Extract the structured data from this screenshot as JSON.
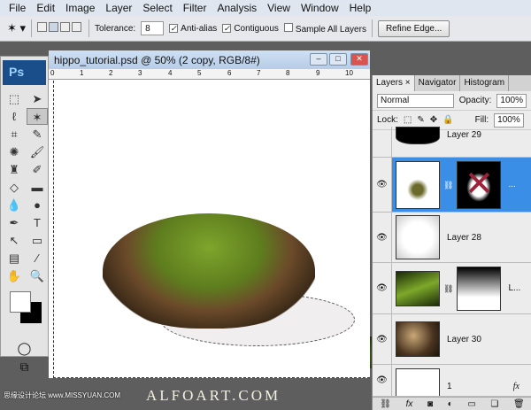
{
  "menu": [
    "File",
    "Edit",
    "Image",
    "Layer",
    "Select",
    "Filter",
    "Analysis",
    "View",
    "Window",
    "Help"
  ],
  "options": {
    "tool_icon": "magic-wand-icon",
    "tolerance_label": "Tolerance:",
    "tolerance_value": "8",
    "anti_alias": {
      "label": "Anti-alias",
      "checked": true
    },
    "contiguous": {
      "label": "Contiguous",
      "checked": true
    },
    "sample_all": {
      "label": "Sample All Layers",
      "checked": false
    },
    "refine_edge": "Refine Edge..."
  },
  "toolbox": {
    "logo": "Ps",
    "tools": [
      "marquee",
      "move",
      "lasso",
      "magic-wand",
      "crop",
      "slice",
      "healing",
      "brush",
      "stamp",
      "history-brush",
      "eraser",
      "gradient",
      "blur",
      "dodge",
      "pen",
      "type",
      "path-select",
      "shape",
      "notes",
      "eyedropper",
      "hand",
      "zoom"
    ],
    "active": "magic-wand",
    "foreground": "#ffffff",
    "background": "#000000"
  },
  "document": {
    "title": "hippo_tutorial.psd @ 50% (2 copy, RGB/8#)",
    "ruler": [
      "0",
      "1",
      "2",
      "3",
      "4",
      "5",
      "6",
      "7",
      "8",
      "9",
      "10"
    ]
  },
  "layers_panel": {
    "tabs": [
      "Layers ×",
      "Navigator",
      "Histogram"
    ],
    "blend_mode": "Normal",
    "opacity_label": "Opacity:",
    "opacity": "100%",
    "lock_label": "Lock:",
    "fill_label": "Fill:",
    "fill": "100%",
    "layers": [
      {
        "name": "Layer 29",
        "visible": false
      },
      {
        "name": "...",
        "visible": true,
        "selected": true
      },
      {
        "name": "Layer 28",
        "visible": true
      },
      {
        "name": "L...",
        "visible": true
      },
      {
        "name": "Layer 30",
        "visible": true
      },
      {
        "name": "1",
        "visible": true,
        "fx": "fx"
      }
    ],
    "bottom_icons": [
      "link",
      "fx",
      "mask",
      "adjustment",
      "group",
      "new-layer",
      "trash"
    ]
  },
  "watermark": {
    "site1": "思缘设计论坛 www.MISSYUAN.COM",
    "site2": "ALFOART.COM"
  },
  "colors": {
    "selected_layer": "#3a8ee6"
  }
}
